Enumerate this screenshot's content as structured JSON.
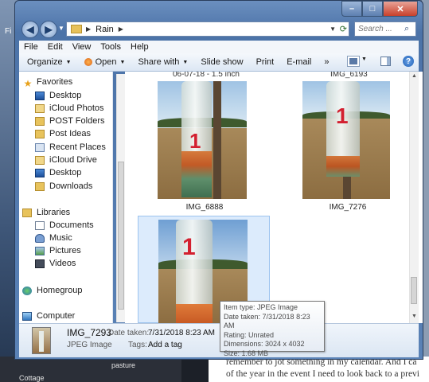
{
  "background": {
    "left_fragment": "Fi",
    "pasture_label": "pasture",
    "cottage_label": "Cottage",
    "article_lines": [
      "remember to jot something in my calendar.  And I ca",
      "of the year in the event I need to look back to a previ"
    ]
  },
  "window": {
    "caption_buttons": {
      "minimize": "–",
      "maximize": "□",
      "close": "✕"
    }
  },
  "address": {
    "path": "Rain",
    "search_placeholder": "Search ..."
  },
  "menu": [
    "File",
    "Edit",
    "View",
    "Tools",
    "Help"
  ],
  "toolbar": {
    "organize": "Organize",
    "open": "Open",
    "share_with": "Share with",
    "slide_show": "Slide show",
    "print": "Print",
    "email": "E-mail",
    "more": "»",
    "help": "?"
  },
  "nav_pane": {
    "favorites": "Favorites",
    "items": [
      "Desktop",
      "iCloud Photos",
      "POST Folders",
      "Post Ideas",
      "Recent Places",
      "iCloud Drive",
      "Desktop",
      "Downloads"
    ],
    "libraries": "Libraries",
    "library_items": [
      "Documents",
      "Music",
      "Pictures",
      "Videos"
    ],
    "homegroup": "Homegroup",
    "computer": "Computer"
  },
  "content": {
    "top_captions": [
      "06-07-18 - 1.5 inch",
      "IMG_6193"
    ],
    "thumbnails": [
      {
        "label": "IMG_6888",
        "mark": "1"
      },
      {
        "label": "IMG_7276",
        "mark": "1"
      },
      {
        "label": "",
        "mark": "1"
      }
    ]
  },
  "tooltip": {
    "lines": [
      "Item type: JPEG Image",
      "Date taken: 7/31/2018 8:23 AM",
      "Rating: Unrated",
      "Dimensions: 3024 x 4032",
      "Size: 1.68 MB"
    ]
  },
  "details": {
    "name": "IMG_7293",
    "type": "JPEG Image",
    "date_label": "Date taken:",
    "date_value": "7/31/2018 8:23 AM",
    "tags_label": "Tags:",
    "tags_value": "Add a tag"
  }
}
